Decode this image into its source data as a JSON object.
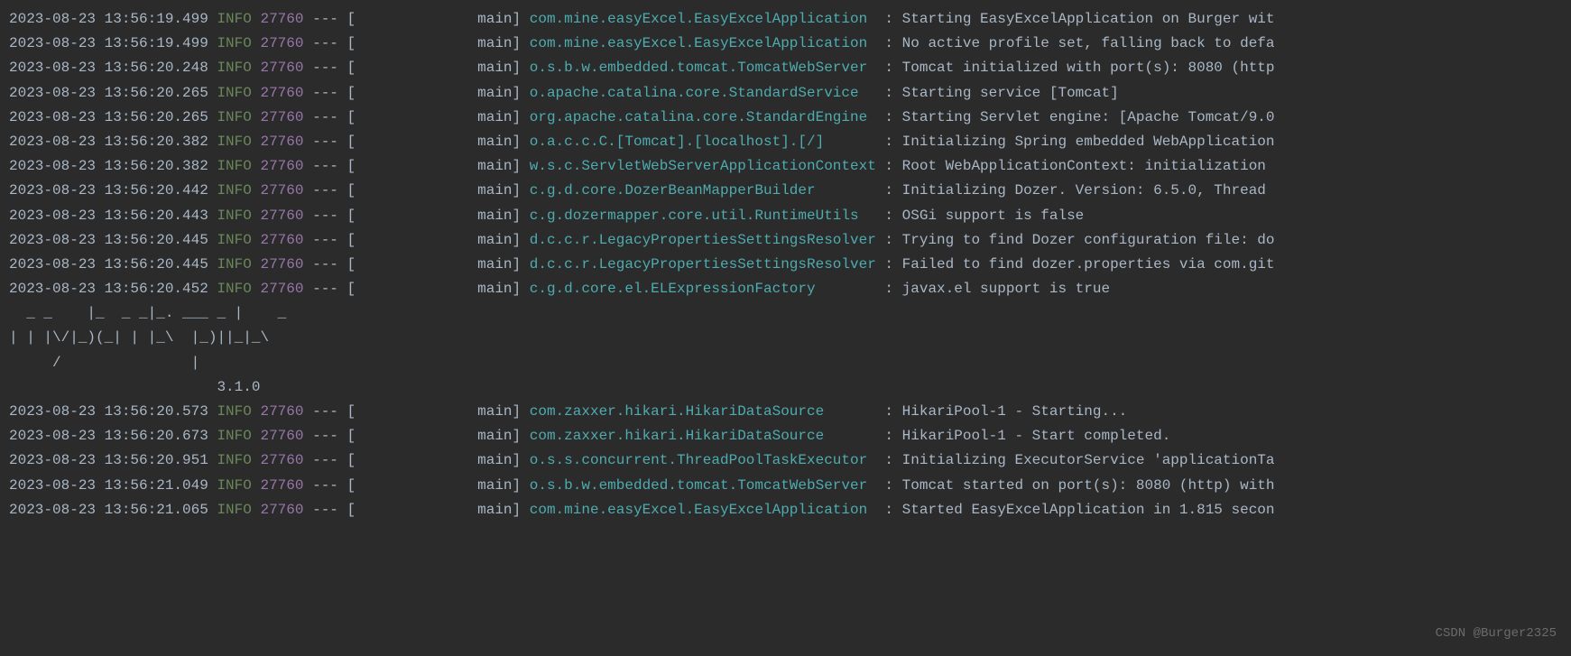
{
  "logs_before": [
    {
      "timestamp": "2023-08-23 13:56:19.499",
      "level": "INFO",
      "pid": "27760",
      "dashes": "---",
      "thread_open": "[",
      "thread": "main]",
      "logger": "com.mine.easyExcel.EasyExcelApplication  ",
      "sep": ":",
      "message": "Starting EasyExcelApplication on Burger wit"
    },
    {
      "timestamp": "2023-08-23 13:56:19.499",
      "level": "INFO",
      "pid": "27760",
      "dashes": "---",
      "thread_open": "[",
      "thread": "main]",
      "logger": "com.mine.easyExcel.EasyExcelApplication  ",
      "sep": ":",
      "message": "No active profile set, falling back to defa"
    },
    {
      "timestamp": "2023-08-23 13:56:20.248",
      "level": "INFO",
      "pid": "27760",
      "dashes": "---",
      "thread_open": "[",
      "thread": "main]",
      "logger": "o.s.b.w.embedded.tomcat.TomcatWebServer  ",
      "sep": ":",
      "message": "Tomcat initialized with port(s): 8080 (http"
    },
    {
      "timestamp": "2023-08-23 13:56:20.265",
      "level": "INFO",
      "pid": "27760",
      "dashes": "---",
      "thread_open": "[",
      "thread": "main]",
      "logger": "o.apache.catalina.core.StandardService   ",
      "sep": ":",
      "message": "Starting service [Tomcat]"
    },
    {
      "timestamp": "2023-08-23 13:56:20.265",
      "level": "INFO",
      "pid": "27760",
      "dashes": "---",
      "thread_open": "[",
      "thread": "main]",
      "logger": "org.apache.catalina.core.StandardEngine  ",
      "sep": ":",
      "message": "Starting Servlet engine: [Apache Tomcat/9.0"
    },
    {
      "timestamp": "2023-08-23 13:56:20.382",
      "level": "INFO",
      "pid": "27760",
      "dashes": "---",
      "thread_open": "[",
      "thread": "main]",
      "logger": "o.a.c.c.C.[Tomcat].[localhost].[/]       ",
      "sep": ":",
      "message": "Initializing Spring embedded WebApplication"
    },
    {
      "timestamp": "2023-08-23 13:56:20.382",
      "level": "INFO",
      "pid": "27760",
      "dashes": "---",
      "thread_open": "[",
      "thread": "main]",
      "logger": "w.s.c.ServletWebServerApplicationContext ",
      "sep": ":",
      "message": "Root WebApplicationContext: initialization "
    },
    {
      "timestamp": "2023-08-23 13:56:20.442",
      "level": "INFO",
      "pid": "27760",
      "dashes": "---",
      "thread_open": "[",
      "thread": "main]",
      "logger": "c.g.d.core.DozerBeanMapperBuilder        ",
      "sep": ":",
      "message": "Initializing Dozer. Version: 6.5.0, Thread "
    },
    {
      "timestamp": "2023-08-23 13:56:20.443",
      "level": "INFO",
      "pid": "27760",
      "dashes": "---",
      "thread_open": "[",
      "thread": "main]",
      "logger": "c.g.dozermapper.core.util.RuntimeUtils   ",
      "sep": ":",
      "message": "OSGi support is false"
    },
    {
      "timestamp": "2023-08-23 13:56:20.445",
      "level": "INFO",
      "pid": "27760",
      "dashes": "---",
      "thread_open": "[",
      "thread": "main]",
      "logger": "d.c.c.r.LegacyPropertiesSettingsResolver ",
      "sep": ":",
      "message": "Trying to find Dozer configuration file: do"
    },
    {
      "timestamp": "2023-08-23 13:56:20.445",
      "level": "INFO",
      "pid": "27760",
      "dashes": "---",
      "thread_open": "[",
      "thread": "main]",
      "logger": "d.c.c.r.LegacyPropertiesSettingsResolver ",
      "sep": ":",
      "message": "Failed to find dozer.properties via com.git"
    },
    {
      "timestamp": "2023-08-23 13:56:20.452",
      "level": "INFO",
      "pid": "27760",
      "dashes": "---",
      "thread_open": "[",
      "thread": "main]",
      "logger": "c.g.d.core.el.ELExpressionFactory        ",
      "sep": ":",
      "message": "javax.el support is true"
    }
  ],
  "ascii_art": [
    "  _ _    |_  _ _|_. ___ _ |    _ ",
    "| | |\\/|_)(_| | |_\\  |_)||_|_\\ ",
    "     /               |         "
  ],
  "version_line": "                        3.1.0 ",
  "logs_after": [
    {
      "timestamp": "2023-08-23 13:56:20.573",
      "level": "INFO",
      "pid": "27760",
      "dashes": "---",
      "thread_open": "[",
      "thread": "main]",
      "logger": "com.zaxxer.hikari.HikariDataSource       ",
      "sep": ":",
      "message": "HikariPool-1 - Starting..."
    },
    {
      "timestamp": "2023-08-23 13:56:20.673",
      "level": "INFO",
      "pid": "27760",
      "dashes": "---",
      "thread_open": "[",
      "thread": "main]",
      "logger": "com.zaxxer.hikari.HikariDataSource       ",
      "sep": ":",
      "message": "HikariPool-1 - Start completed."
    },
    {
      "timestamp": "2023-08-23 13:56:20.951",
      "level": "INFO",
      "pid": "27760",
      "dashes": "---",
      "thread_open": "[",
      "thread": "main]",
      "logger": "o.s.s.concurrent.ThreadPoolTaskExecutor  ",
      "sep": ":",
      "message": "Initializing ExecutorService 'applicationTa"
    },
    {
      "timestamp": "2023-08-23 13:56:21.049",
      "level": "INFO",
      "pid": "27760",
      "dashes": "---",
      "thread_open": "[",
      "thread": "main]",
      "logger": "o.s.b.w.embedded.tomcat.TomcatWebServer  ",
      "sep": ":",
      "message": "Tomcat started on port(s): 8080 (http) with"
    },
    {
      "timestamp": "2023-08-23 13:56:21.065",
      "level": "INFO",
      "pid": "27760",
      "dashes": "---",
      "thread_open": "[",
      "thread": "main]",
      "logger": "com.mine.easyExcel.EasyExcelApplication  ",
      "sep": ":",
      "message": "Started EasyExcelApplication in 1.815 secon"
    }
  ],
  "watermark": "CSDN @Burger2325"
}
